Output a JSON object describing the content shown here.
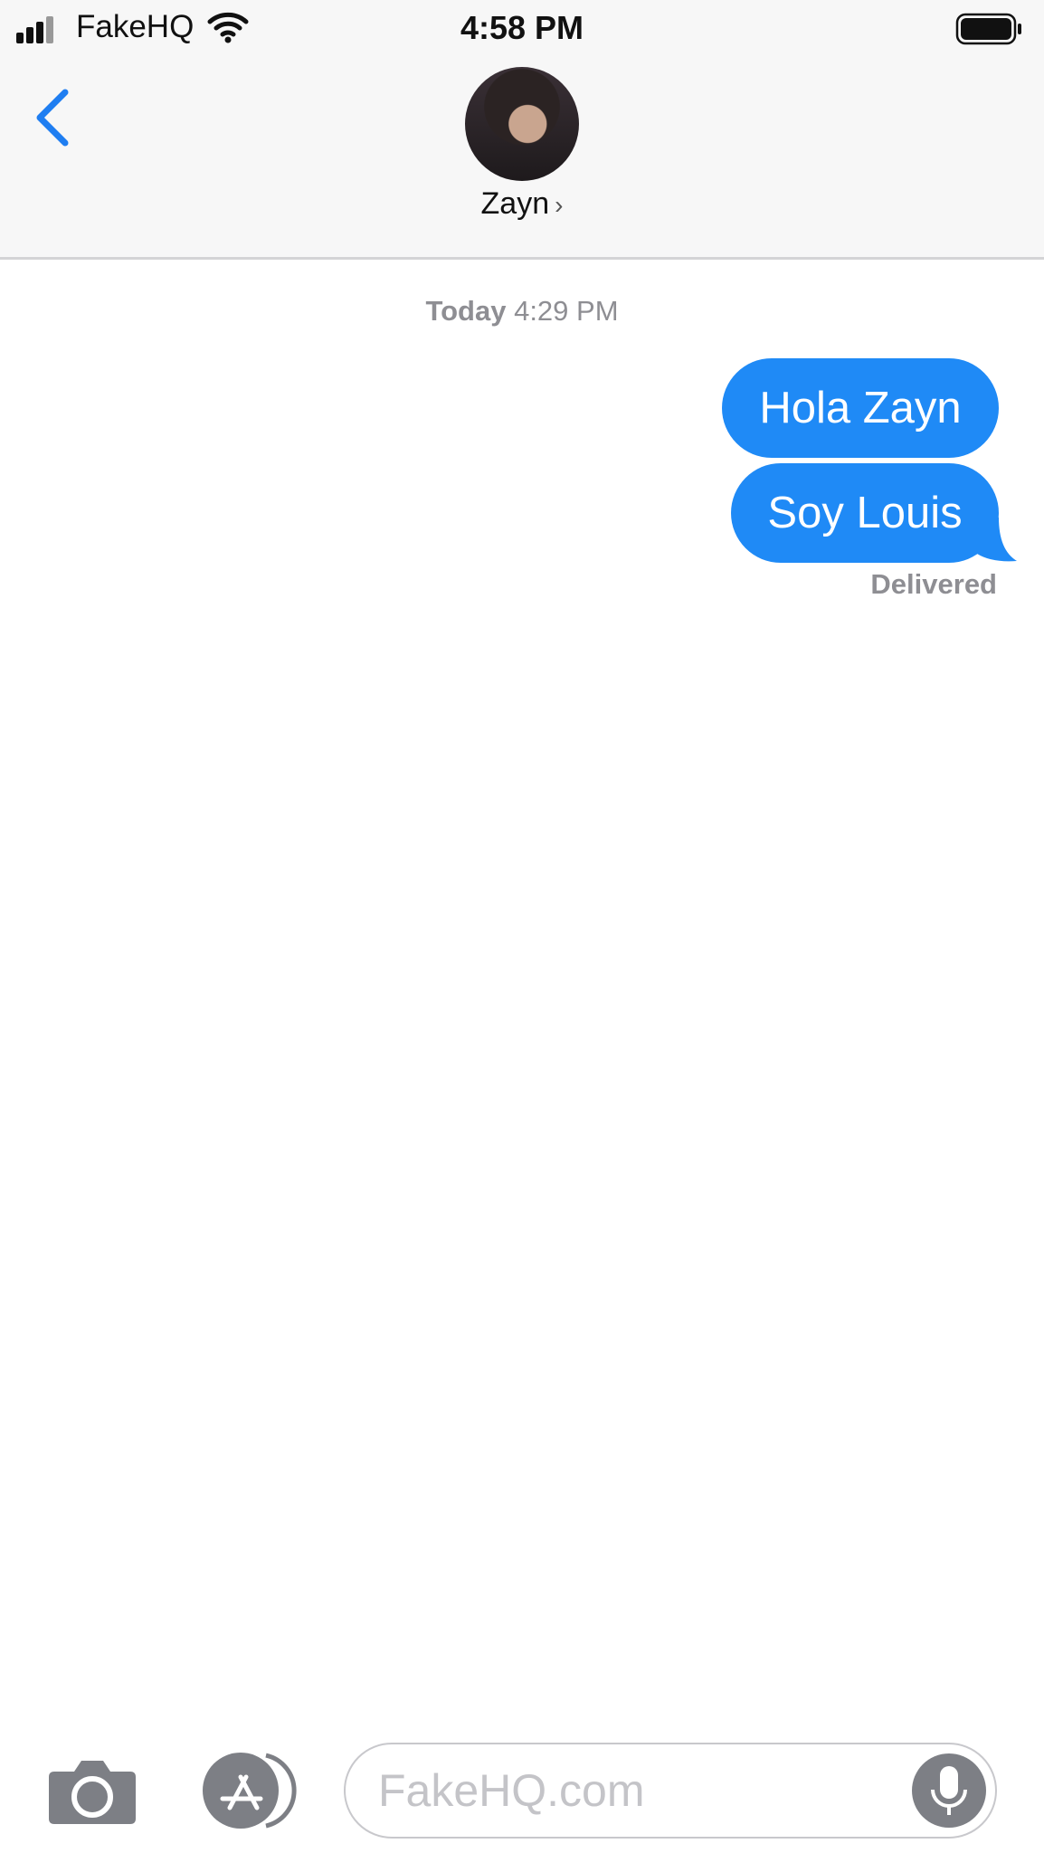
{
  "status_bar": {
    "carrier": "FakeHQ",
    "time": "4:58 PM",
    "signal_icon": "signal-bars-icon",
    "wifi_icon": "wifi-icon",
    "battery_icon": "battery-icon"
  },
  "header": {
    "back_icon": "chevron-left-icon",
    "contact_name": "Zayn",
    "chevron": "›",
    "accent_color": "#1f7ef1"
  },
  "thread": {
    "timestamp_day": "Today",
    "timestamp_time": "4:29 PM",
    "messages": [
      {
        "text": "Hola Zayn",
        "sender": "me"
      },
      {
        "text": "Soy Louis",
        "sender": "me"
      }
    ],
    "status": "Delivered",
    "bubble_color": "#1f8af6"
  },
  "composer": {
    "camera_icon": "camera-icon",
    "appstore_icon": "app-store-icon",
    "placeholder": "FakeHQ.com",
    "mic_icon": "microphone-icon"
  }
}
